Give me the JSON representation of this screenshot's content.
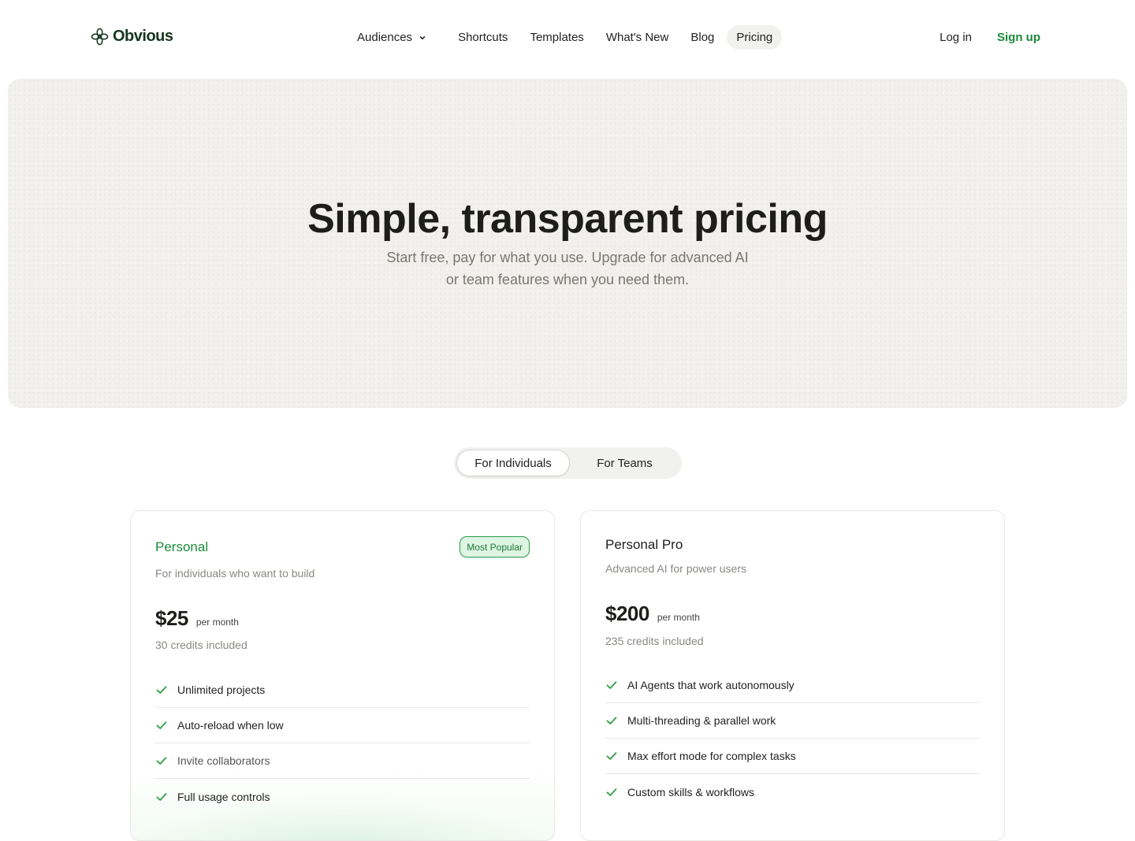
{
  "brand": {
    "name": "Obvious",
    "color": "#16351f",
    "accent": "#1b8a3a"
  },
  "nav": {
    "links": [
      {
        "label": "Audiences",
        "has_dropdown": true
      },
      {
        "label": "Shortcuts"
      },
      {
        "label": "Templates"
      },
      {
        "label": "What's New"
      },
      {
        "label": "Blog"
      },
      {
        "label": "Pricing",
        "active": true
      }
    ],
    "login": "Log in",
    "signup": "Sign up"
  },
  "hero": {
    "title": "Simple, transparent pricing",
    "subtitle": "Start free, pay for what you use. Upgrade for advanced AI or team features when you need them."
  },
  "toggle": {
    "options": [
      {
        "label": "For Individuals",
        "selected": true
      },
      {
        "label": "For Teams",
        "selected": false
      }
    ]
  },
  "plans": [
    {
      "name": "Personal",
      "badge": "Most Popular",
      "description": "For individuals who want to build",
      "price": "$25",
      "period": "per month",
      "credits": "30 credits included",
      "features": [
        "Unlimited projects",
        "Auto-reload when low",
        "Invite collaborators",
        "Full usage controls"
      ]
    },
    {
      "name": "Personal Pro",
      "description": "Advanced AI for power users",
      "price": "$200",
      "period": "per month",
      "credits": "235 credits included",
      "features": [
        "AI Agents that work autonomously",
        "Multi-threading & parallel work",
        "Max effort mode for complex tasks",
        "Custom skills & workflows"
      ]
    }
  ],
  "icons": {
    "logo": "obvious-flower-logo-icon",
    "dropdown": "chevron-down-icon",
    "feature": "check-icon"
  },
  "colors": {
    "check": "#2e9e3f",
    "hero_bg": "#f1f0ed",
    "badge_bg": "#dff5e3",
    "badge_border": "#2a9a4a"
  }
}
